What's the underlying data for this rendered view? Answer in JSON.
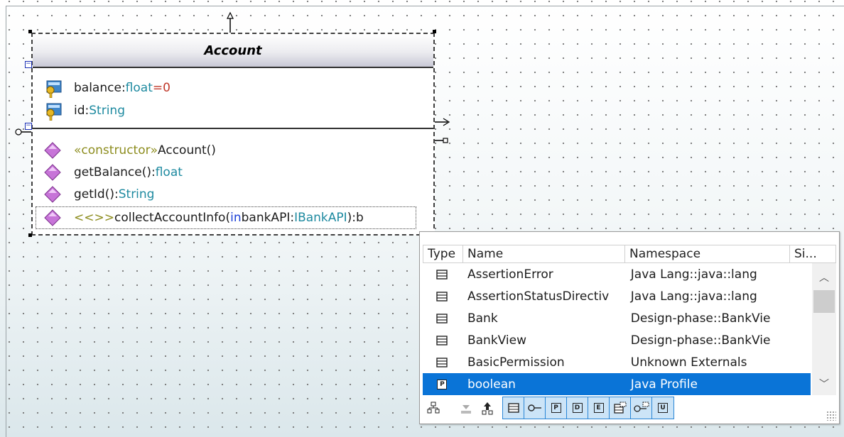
{
  "class_box": {
    "name": "Account",
    "attributes": [
      {
        "name": "balance",
        "sep": ":",
        "type": "float",
        "default": "=0"
      },
      {
        "name": "id",
        "sep": ":",
        "type": "String"
      }
    ],
    "operations": [
      {
        "stereotype": "«constructor»",
        "name": " Account()",
        "type_sep": "",
        "type": ""
      },
      {
        "stereotype": "",
        "name": "getBalance()",
        "type_sep": ":",
        "type": "float"
      },
      {
        "stereotype": "",
        "name": "getId()",
        "type_sep": ":",
        "type": "String"
      }
    ],
    "editing_row": {
      "stereotype": "<<>>",
      "name": " collectAccountInfo(",
      "direction": "in",
      "param_name": " bankAPI:",
      "param_type": "IBankAPI",
      "tail": "):b"
    }
  },
  "popup": {
    "input_value": "",
    "columns": [
      "Type",
      "Name",
      "Namespace",
      "Si..."
    ],
    "rows": [
      {
        "type_icon": "class-icon",
        "name": "AssertionError",
        "namespace": "Java Lang::java::lang"
      },
      {
        "type_icon": "class-icon",
        "name": "AssertionStatusDirectiv",
        "namespace": "Java Lang::java::lang"
      },
      {
        "type_icon": "class-icon",
        "name": "Bank",
        "namespace": "Design-phase::BankVie"
      },
      {
        "type_icon": "class-icon",
        "name": "BankView",
        "namespace": "Design-phase::BankVie"
      },
      {
        "type_icon": "class-icon",
        "name": "BasicPermission",
        "namespace": "Unknown Externals"
      },
      {
        "type_icon": "primitive-icon",
        "name": "boolean",
        "namespace": "Java Profile",
        "selected": true
      }
    ],
    "toolbar_letters": {
      "primitive": "P",
      "datatype": "D",
      "enumeration": "E",
      "template": "U"
    }
  },
  "colors": {
    "selection": "#0a74d7",
    "type_text": "#1e8aa0",
    "default_value": "#c0392b",
    "stereotype": "#8d8d1f",
    "direction_kw": "#1b3fd6",
    "operation_icon": "#c774d8",
    "attribute_icon": "#3f86c9"
  }
}
